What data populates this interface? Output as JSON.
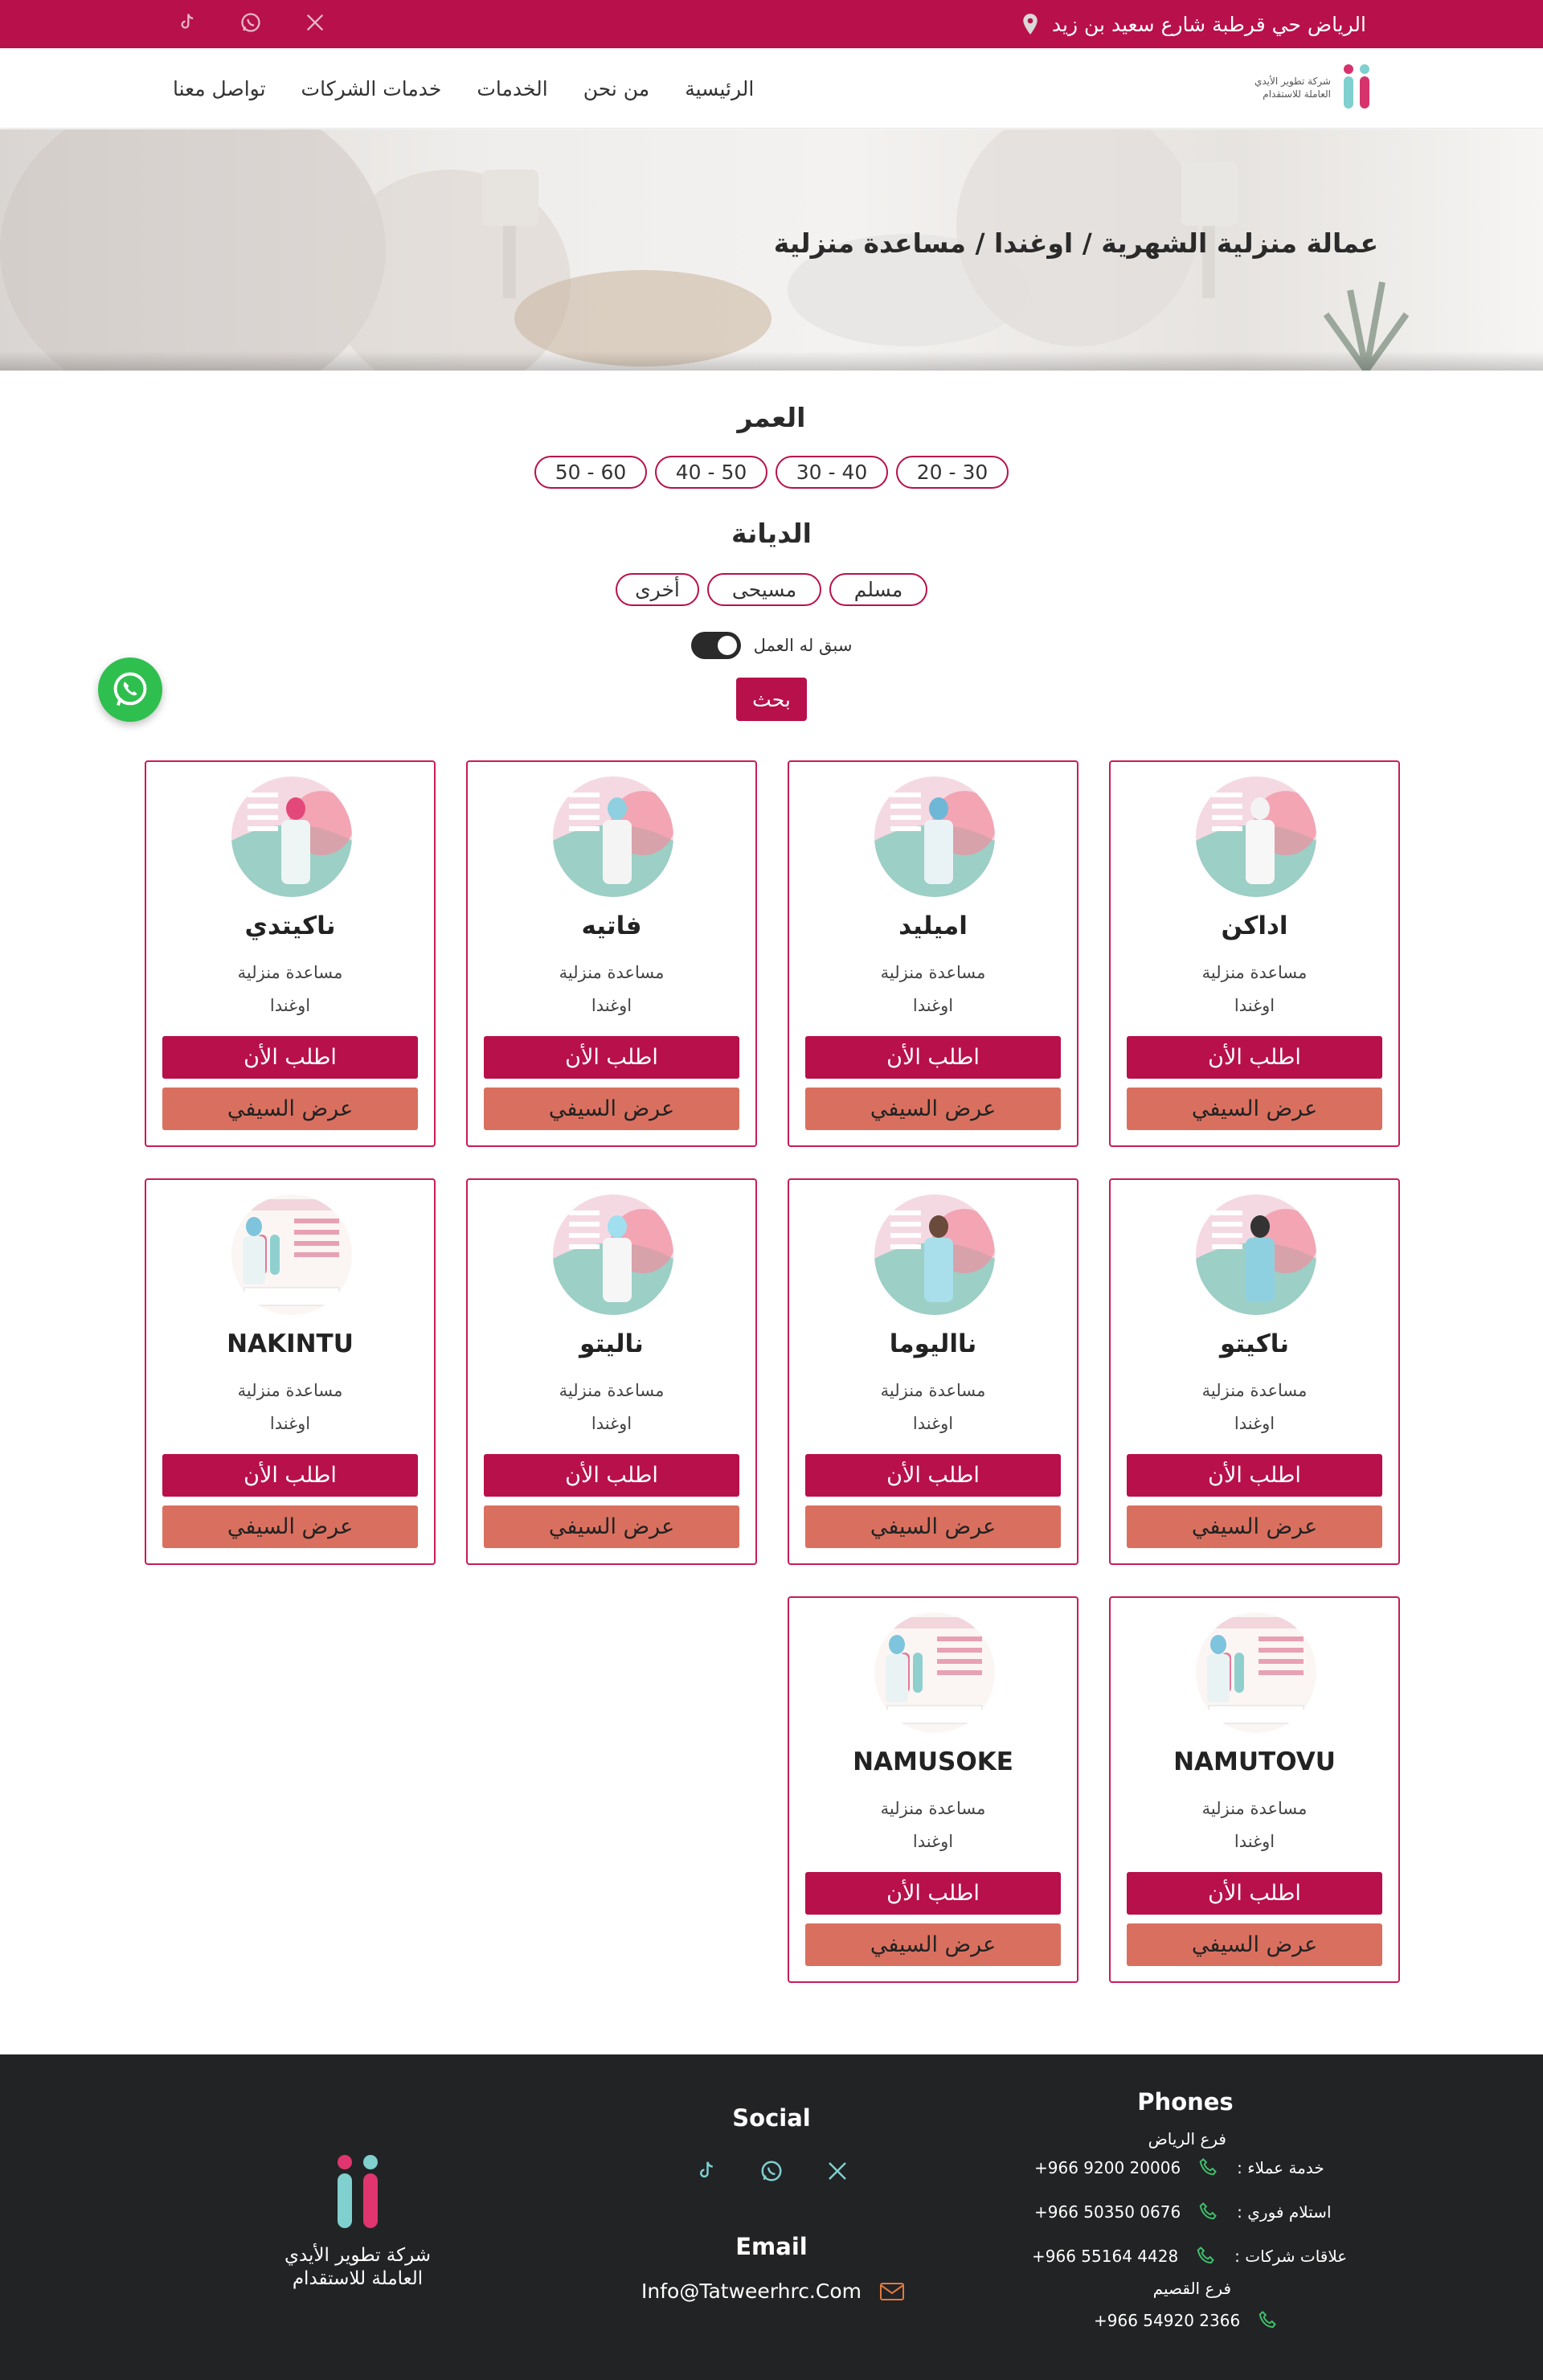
{
  "topbar": {
    "address": "الرياض حي قرطبة شارع سعيد بن زيد",
    "socials": [
      "tiktok-icon",
      "whatsapp-icon",
      "x-icon"
    ]
  },
  "brand": {
    "name_line1": "شركة تطوير الأيدي",
    "name_line2": "العاملة للاستقدام",
    "accent": "#b8104a",
    "cv_button_color": "#d9705f"
  },
  "nav": {
    "home": "الرئيسية",
    "about": "من نحن",
    "services": "الخدمات",
    "company_services": "خدمات الشركات",
    "contact": "تواصل معنا"
  },
  "hero": {
    "title": "عمالة منزلية الشهرية / اوغندا / مساعدة منزلية"
  },
  "filters": {
    "age_title": "العمر",
    "ages": [
      "20 - 30",
      "30 - 40",
      "40 - 50",
      "50 - 60"
    ],
    "religion_title": "الديانة",
    "religions": [
      "مسلم",
      "مسيحى",
      "أخرى"
    ],
    "experience_label": "سبق له العمل",
    "search_label": "بحث"
  },
  "cards": [
    {
      "name": "اداكن",
      "role": "مساعدة منزلية",
      "country": "اوغندا",
      "request": "اطلب الأن",
      "cv": "عرض السيفي"
    },
    {
      "name": "اميليد",
      "role": "مساعدة منزلية",
      "country": "اوغندا",
      "request": "اطلب الأن",
      "cv": "عرض السيفي"
    },
    {
      "name": "فاتيه",
      "role": "مساعدة منزلية",
      "country": "اوغندا",
      "request": "اطلب الأن",
      "cv": "عرض السيفي"
    },
    {
      "name": "ناكيتدي",
      "role": "مساعدة منزلية",
      "country": "اوغندا",
      "request": "اطلب الأن",
      "cv": "عرض السيفي"
    },
    {
      "name": "ناكيتو",
      "role": "مساعدة منزلية",
      "country": "اوغندا",
      "request": "اطلب الأن",
      "cv": "عرض السيفي"
    },
    {
      "name": "نااليوما",
      "role": "مساعدة منزلية",
      "country": "اوغندا",
      "request": "اطلب الأن",
      "cv": "عرض السيفي"
    },
    {
      "name": "ناليتو",
      "role": "مساعدة منزلية",
      "country": "اوغندا",
      "request": "اطلب الأن",
      "cv": "عرض السيفي"
    },
    {
      "name": "NAKINTU",
      "role": "مساعدة منزلية",
      "country": "اوغندا",
      "request": "اطلب الأن",
      "cv": "عرض السيفي"
    },
    {
      "name": "NAMUTOVU",
      "role": "مساعدة منزلية",
      "country": "اوغندا",
      "request": "اطلب الأن",
      "cv": "عرض السيفي"
    },
    {
      "name": "NAMUSOKE",
      "role": "مساعدة منزلية",
      "country": "اوغندا",
      "request": "اطلب الأن",
      "cv": "عرض السيفي"
    }
  ],
  "footer": {
    "social_title": "Social",
    "email_title": "Email",
    "email": "Info@Tatweerhrc.Com",
    "phones_title": "Phones",
    "riyadh_branch": "فرع الرياض",
    "customer_service_label": "خدمة عملاء :",
    "customer_service_phone": "+966 9200 20006",
    "receipt_label": "استلام فوري :",
    "receipt_phone": "+966 50350 0676",
    "companies_label": "علاقات شركات :",
    "companies_phone": "+966 55164 4428",
    "qassim_branch": "فرع القصيم",
    "qassim_phone": "+966 54920 2366"
  }
}
